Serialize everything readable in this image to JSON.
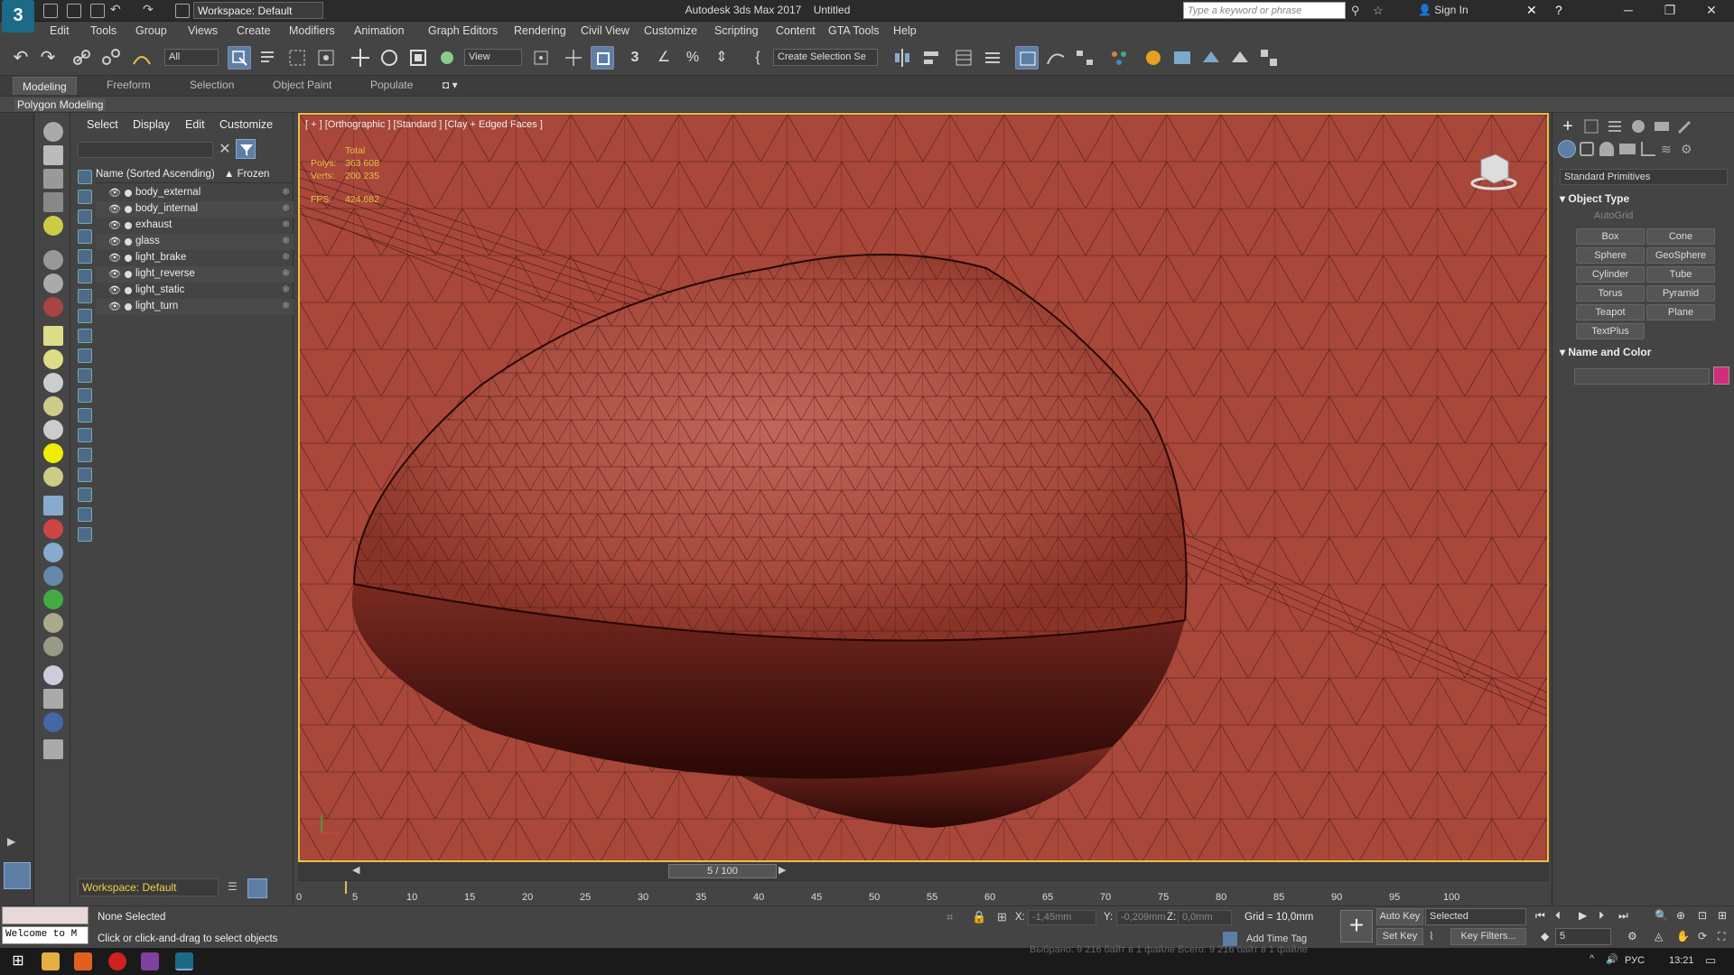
{
  "titlebar": {
    "workspace": "Workspace: Default",
    "app_title": "Autodesk 3ds Max 2017",
    "doc_title": "Untitled",
    "search_placeholder": "Type a keyword or phrase",
    "sign_in": "Sign In"
  },
  "menu": [
    "Edit",
    "Tools",
    "Group",
    "Views",
    "Create",
    "Modifiers",
    "Animation",
    "Graph Editors",
    "Rendering",
    "Civil View",
    "Customize",
    "Scripting",
    "Content",
    "GTA Tools",
    "Help"
  ],
  "toolbar": {
    "filter_select": "All",
    "ref_coord": "View",
    "selection_set": "Create Selection Se"
  },
  "ribbon": {
    "tabs": [
      "Modeling",
      "Freeform",
      "Selection",
      "Object Paint",
      "Populate"
    ],
    "active": "Modeling",
    "sub_label": "Polygon Modeling"
  },
  "explorer": {
    "menu": [
      "Select",
      "Display",
      "Edit",
      "Customize"
    ],
    "col_name": "Name (Sorted Ascending)",
    "col_frozen": "▲ Frozen",
    "objects": [
      "body_external",
      "body_internal",
      "exhaust",
      "glass",
      "light_brake",
      "light_reverse",
      "light_static",
      "light_turn"
    ],
    "workspace": "Workspace: Default"
  },
  "viewport": {
    "label": "[ + ] [Orthographic ] [Standard ] [Clay + Edged Faces ]",
    "stats": {
      "total_label": "Total",
      "polys_label": "Polys:",
      "polys": "363 608",
      "verts_label": "Verts:",
      "verts": "200 235",
      "fps_label": "FPS:",
      "fps": "424,682"
    }
  },
  "cmdpanel": {
    "category": "Standard Primitives",
    "object_type": "Object Type",
    "autogrid": "AutoGrid",
    "primitives": [
      "Box",
      "Cone",
      "Sphere",
      "GeoSphere",
      "Cylinder",
      "Tube",
      "Torus",
      "Pyramid",
      "Teapot",
      "Plane",
      "TextPlus"
    ],
    "name_and_color": "Name and Color",
    "color": "#d22c7c"
  },
  "timeline": {
    "frame": "5 / 100",
    "ticks": [
      "0",
      "5",
      "10",
      "15",
      "20",
      "25",
      "30",
      "35",
      "40",
      "45",
      "50",
      "55",
      "60",
      "65",
      "70",
      "75",
      "80",
      "85",
      "90",
      "95",
      "100"
    ]
  },
  "status": {
    "script_text": "Welcome to M",
    "selection": "None Selected",
    "hint": "Click or click-and-drag to select objects",
    "x_label": "X:",
    "x_val": "-1,45mm",
    "y_label": "Y:",
    "y_val": "-0,209mm",
    "z_label": "Z:",
    "z_val": "0,0mm",
    "grid": "Grid = 10,0mm",
    "add_time_tag": "Add Time Tag",
    "auto_key": "Auto Key",
    "set_key": "Set Key",
    "selected": "Selected",
    "key_filters": "Key Filters...",
    "frame_field": "5"
  },
  "taskbar": {
    "lang": "РУС",
    "time": "13:21",
    "download": "Выбрано: 9 216 байт в 1 файле        Всего: 9 216 байт в 1 файле"
  }
}
